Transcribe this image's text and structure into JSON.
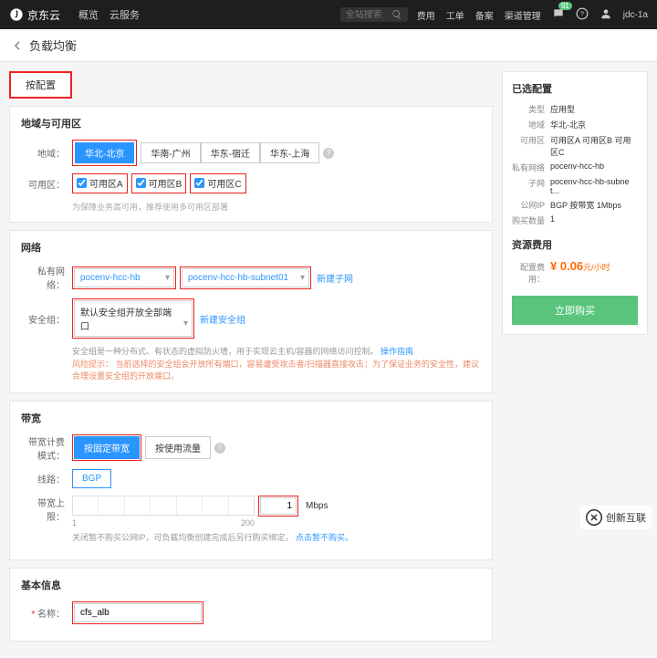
{
  "header": {
    "logo": "京东云",
    "nav": [
      "概览",
      "云服务"
    ],
    "search_placeholder": "全站搜索",
    "right": {
      "cost": "费用",
      "order": "工单",
      "backup": "备案",
      "channel": "渠道管理",
      "badge": "91",
      "user": "jdc-1a"
    }
  },
  "page": {
    "title": "负载均衡"
  },
  "tabs": {
    "active": "按配置"
  },
  "region_section": {
    "title": "地域与可用区",
    "region_label": "地域：",
    "regions": [
      "华北-北京",
      "华南-广州",
      "华东-宿迁",
      "华东-上海"
    ],
    "zone_label": "可用区：",
    "zones": [
      "可用区A",
      "可用区B",
      "可用区C"
    ],
    "zone_hint": "为保障业务高可用，推荐使用多可用区部署"
  },
  "network_section": {
    "title": "网络",
    "vpc_label": "私有网络：",
    "vpc_value": "pocenv-hcc-hb",
    "subnet_value": "pocenv-hcc-hb-subnet01",
    "new_subnet": "新建子网",
    "sg_label": "安全组：",
    "sg_value": "默认安全组开放全部端口",
    "new_sg": "新建安全组",
    "sg_hint": "安全组是一种分布式、有状态的虚拟防火墙，用于实现云主机/容器的网络访问控制。",
    "sg_manual": "操作指南",
    "sg_warn_label": "风险提示：",
    "sg_warn": "当前选择的安全组会开放所有端口，容易遭受攻击者/扫描器直接攻击；为了保证业务的安全性，建议合理设置安全组的开放端口。"
  },
  "bandwidth_section": {
    "title": "带宽",
    "billing_label": "带宽计费模式：",
    "billing_fixed": "按固定带宽",
    "billing_usage": "按使用流量",
    "line_label": "线路：",
    "line_value": "BGP",
    "cap_label": "带宽上限：",
    "cap_value": "1",
    "cap_unit": "Mbps",
    "cap_min": "1",
    "cap_max": "200",
    "cap_hint_prefix": "关闭暂不购买公网IP，可负载均衡创建完成后另行购买绑定。",
    "cap_link": "点击暂不购买。"
  },
  "basic_section": {
    "title": "基本信息",
    "name_label": "名称：",
    "name_value": "cfs_alb"
  },
  "summary": {
    "title": "已选配置",
    "rows": {
      "type_label": "类型",
      "type_value": "应用型",
      "region_label": "地域",
      "region_value": "华北-北京",
      "zone_label": "可用区",
      "zone_value": "可用区A 可用区B 可用区C",
      "vpc_label": "私有网络",
      "vpc_value": "pocenv-hcc-hb",
      "subnet_label": "子网",
      "subnet_value": "pocenv-hcc-hb-subnet...",
      "ip_label": "公网IP",
      "ip_value": "BGP 按带宽 1Mbps",
      "qty_label": "购买数量",
      "qty_value": "1"
    },
    "cost_title": "资源费用",
    "cost_label": "配置费用：",
    "price": "0.06",
    "currency": "¥",
    "price_unit": "元/小时",
    "buy": "立即购买"
  },
  "watermark": "创新互联"
}
